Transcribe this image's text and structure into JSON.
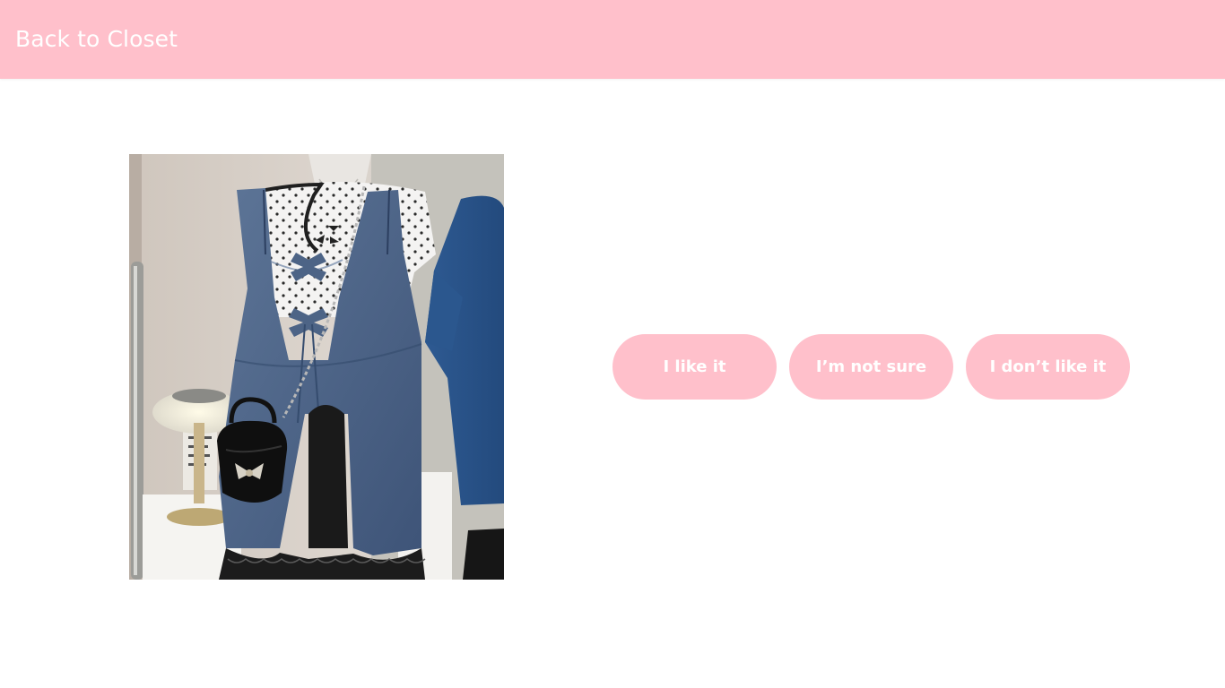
{
  "header": {
    "back_label": "Back to Closet",
    "background_color": "#ffc0cb"
  },
  "product_image": {
    "subject": "denim tie-front babydoll top over polka-dot tee with black shorts and bow handbag on mannequin"
  },
  "choices": [
    {
      "label": "I like it"
    },
    {
      "label": "I’m not sure"
    },
    {
      "label": "I don’t like it"
    }
  ],
  "colors": {
    "accent": "#ffc0cb",
    "button_text": "#ffffff",
    "page_background": "#ffffff"
  }
}
